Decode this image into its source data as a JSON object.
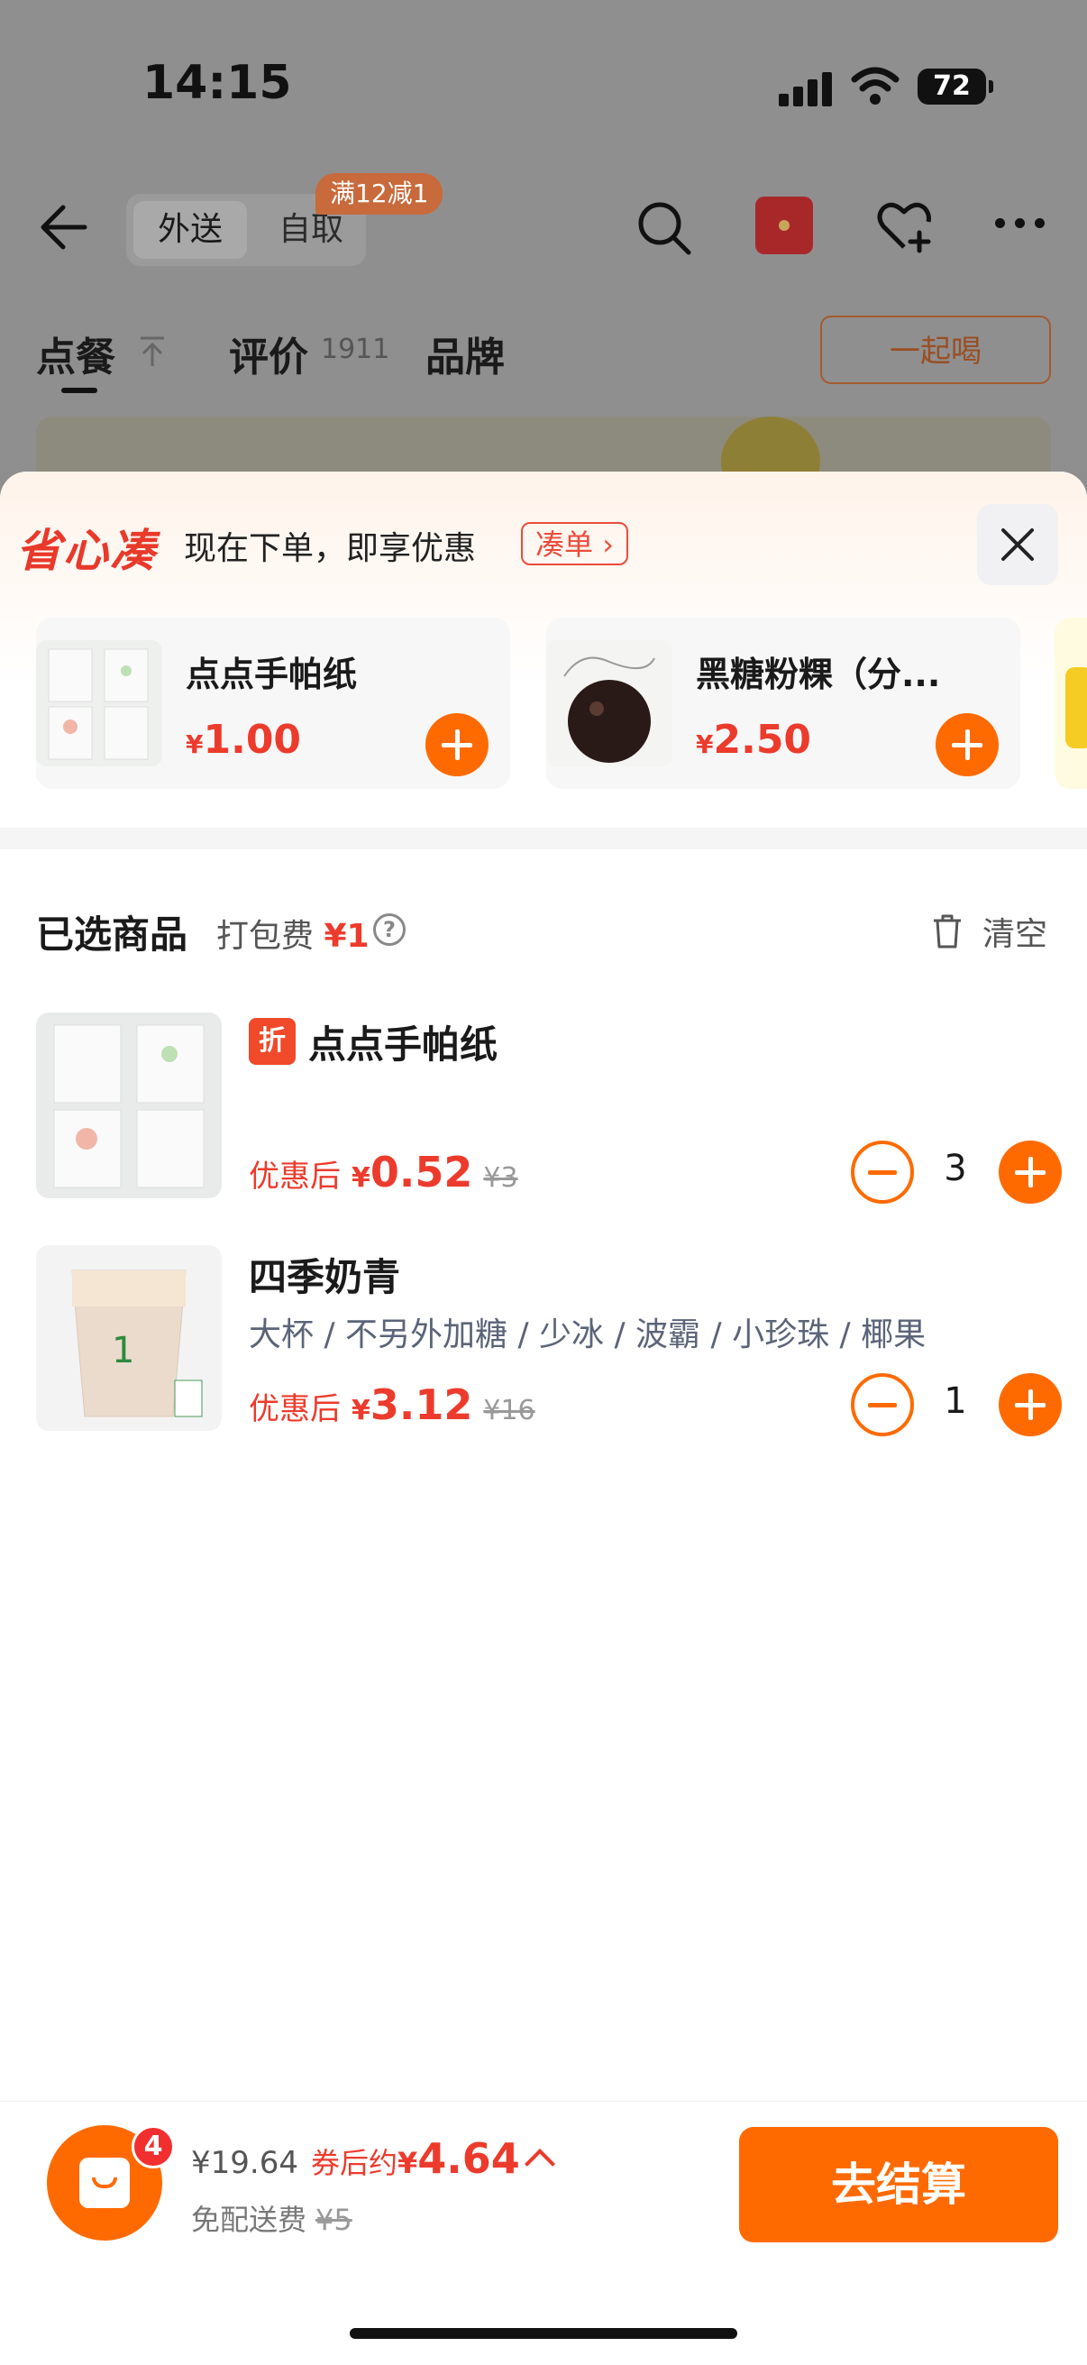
{
  "status": {
    "time": "14:15",
    "battery": "72"
  },
  "header": {
    "mode_tabs": [
      "外送",
      "自取"
    ],
    "promo_tag": "满12减1"
  },
  "tabs": {
    "order": "点餐",
    "reviews": "评价",
    "reviews_count": "1911",
    "brand": "品牌",
    "together_button": "一起喝"
  },
  "upsell": {
    "logo": "省心凑",
    "text": "现在下单，即享优惠",
    "chip": "凑单",
    "items": [
      {
        "name": "点点手帕纸",
        "currency": "¥",
        "price": "1.00"
      },
      {
        "name": "黑糖粉粿（分...",
        "currency": "¥",
        "price": "2.50"
      }
    ]
  },
  "cart": {
    "title": "已选商品",
    "pack_fee_label": "打包费",
    "pack_fee": "¥1",
    "clear_label": "清空",
    "items": [
      {
        "badge": "折",
        "name": "点点手帕纸",
        "spec": "",
        "price_label": "优惠后",
        "currency": "¥",
        "price": "0.52",
        "orig_price": "¥3",
        "qty": "3"
      },
      {
        "badge": "",
        "name": "四季奶青",
        "spec": "大杯 / 不另外加糖 / 少冰 / 波霸 / 小珍珠 / 椰果",
        "price_label": "优惠后",
        "currency": "¥",
        "price": "3.12",
        "orig_price": "¥16",
        "qty": "1"
      }
    ]
  },
  "footer": {
    "count": "4",
    "orig_total": "¥19.64",
    "after_label": "券后约",
    "after_currency": "¥",
    "after_total": "4.64",
    "delivery_label": "免配送费",
    "delivery_orig": "¥5",
    "checkout": "去结算"
  },
  "colors": {
    "accent": "#ff6a00",
    "price_red": "#ec3b2c"
  }
}
